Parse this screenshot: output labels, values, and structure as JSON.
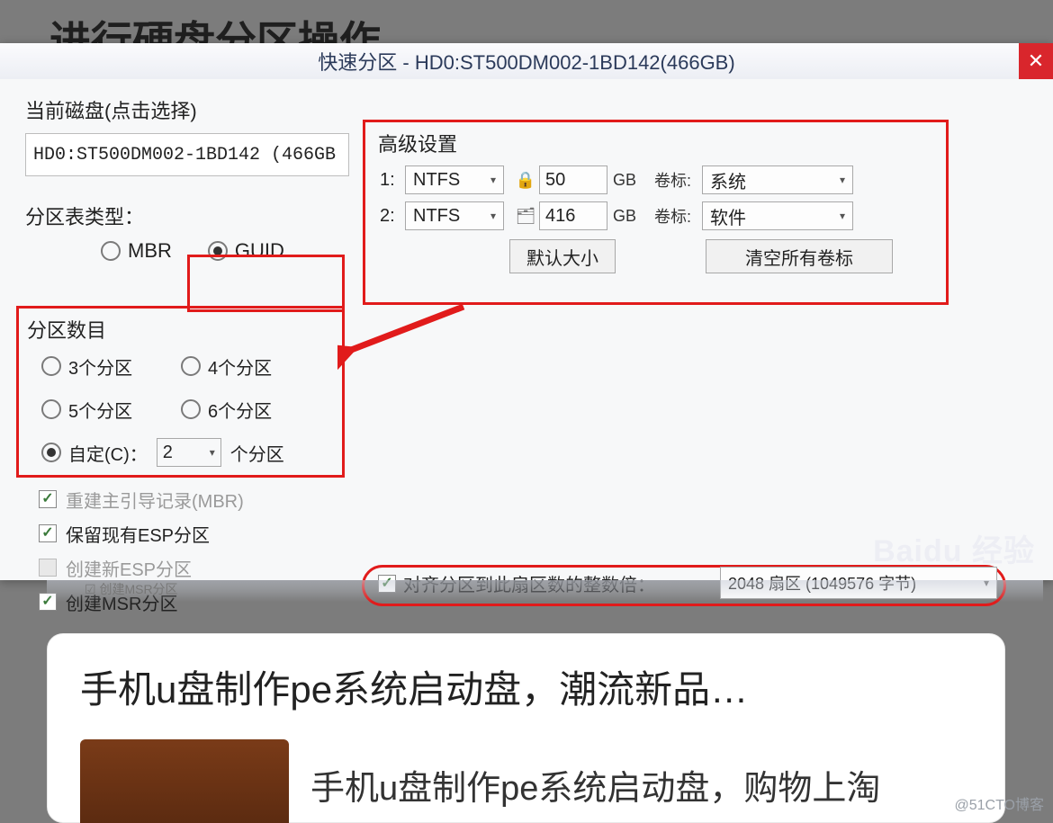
{
  "page": {
    "article_title": "进行硬盘分区操作"
  },
  "dialog": {
    "title": "快速分区 - HD0:ST500DM002-1BD142(466GB)",
    "close_glyph": "✕",
    "current_disk_label": "当前磁盘(点击选择)",
    "current_disk_value": "HD0:ST500DM002-1BD142 (466GB",
    "ptype_label": "分区表类型：",
    "ptype_mbr": "MBR",
    "ptype_guid": "GUID",
    "pcount_title": "分区数目",
    "pcount_3": "3个分区",
    "pcount_4": "4个分区",
    "pcount_5": "5个分区",
    "pcount_6": "6个分区",
    "pcount_custom_label": "自定(C)：",
    "pcount_custom_value": "2",
    "pcount_custom_suffix": "个分区",
    "chk_rebuild_mbr": "重建主引导记录(MBR)",
    "chk_keep_esp": "保留现有ESP分区",
    "chk_new_esp": "创建新ESP分区",
    "chk_msr": "创建MSR分区",
    "adv_title": "高级设置",
    "adv_rows": [
      {
        "idx": "1:",
        "fs": "NTFS",
        "lock": "🔒",
        "size": "50",
        "unit": "GB",
        "vol_label": "卷标:",
        "vol_value": "系统"
      },
      {
        "idx": "2:",
        "fs": "NTFS",
        "lock": "🗂",
        "size": "416",
        "unit": "GB",
        "vol_label": "卷标:",
        "vol_value": "软件"
      }
    ],
    "btn_default_size": "默认大小",
    "btn_clear_labels": "清空所有卷标",
    "align_label": "对齐分区到此扇区数的整数倍：",
    "align_value": "2048 扇区 (1049576 字节)",
    "watermark": "Baidu 经验"
  },
  "faded_duplicate": "☑ 创建MSR分区",
  "ad": {
    "title": "手机u盘制作pe系统启动盘，潮流新品…",
    "text": "手机u盘制作pe系统启动盘，购物上淘"
  },
  "footer": "@51CTO博客"
}
